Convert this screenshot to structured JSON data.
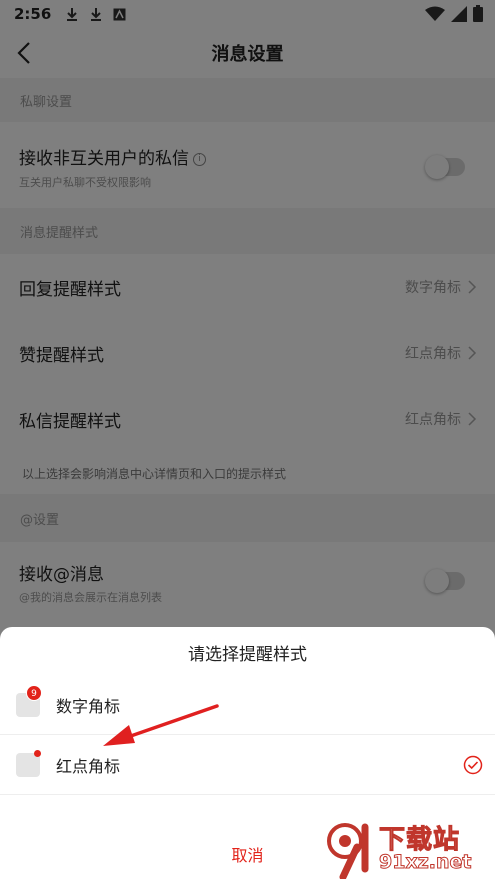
{
  "status_bar": {
    "time": "2:56"
  },
  "nav": {
    "title": "消息设置"
  },
  "sections": {
    "private_chat": "私聊设置",
    "reminder_style": "消息提醒样式",
    "at_settings": "@设置"
  },
  "rows": {
    "receive_nonmutual": {
      "title": "接收非互关用户的私信",
      "subtitle": "互关用户私聊不受权限影响",
      "enabled": false
    },
    "reply_style": {
      "title": "回复提醒样式",
      "value": "数字角标"
    },
    "like_style": {
      "title": "赞提醒样式",
      "value": "红点角标"
    },
    "dm_style": {
      "title": "私信提醒样式",
      "value": "红点角标"
    },
    "style_note": "以上选择会影响消息中心详情页和入口的提示样式",
    "receive_at": {
      "title": "接收@消息",
      "subtitle": "@我的消息会展示在消息列表",
      "enabled": false
    }
  },
  "sheet": {
    "title": "请选择提醒样式",
    "options": [
      {
        "label": "数字角标",
        "badge": "9",
        "selected": false
      },
      {
        "label": "红点角标",
        "selected": true
      }
    ],
    "cancel": "取消"
  },
  "watermark": {
    "text": "下载站",
    "url": "91xz.net"
  },
  "colors": {
    "accent": "#e2231a",
    "overlay": "rgba(0,0,0,0.5)"
  }
}
